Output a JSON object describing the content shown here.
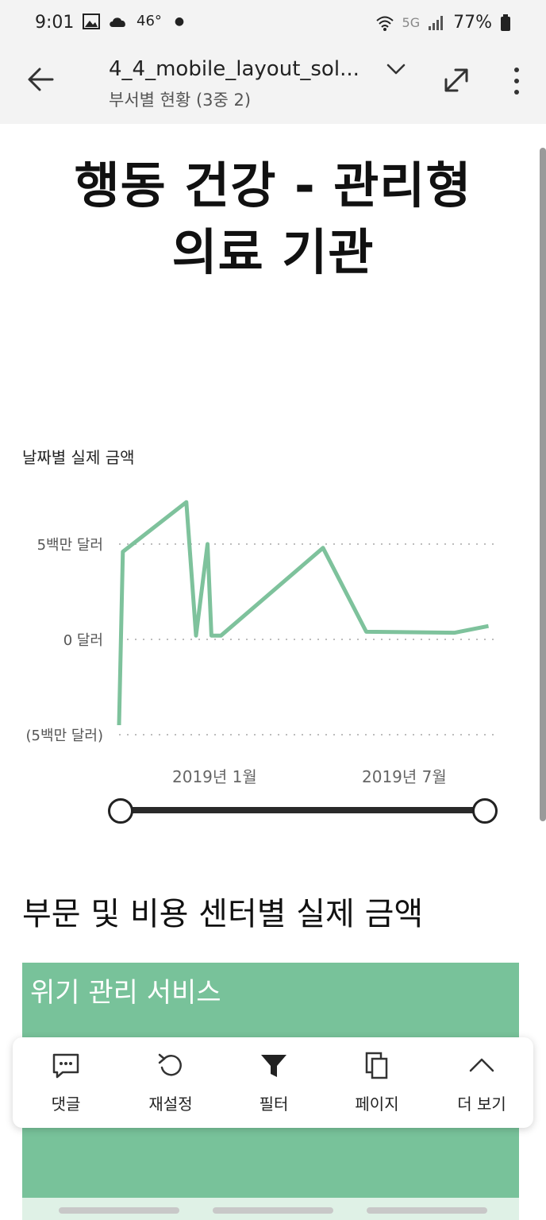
{
  "status_bar": {
    "time": "9:01",
    "temperature": "46°",
    "network": "5G",
    "battery": "77%"
  },
  "app_bar": {
    "title": "4_4_mobile_layout_sol...",
    "subtitle": "부서별 현황 (3중 2)"
  },
  "report": {
    "title_line1": "행동 건강 - 관리형",
    "title_line2": "의료 기관"
  },
  "chart_data": {
    "type": "line",
    "title": "날짜별 실제 금액",
    "y_ticks": [
      "5백만 달러",
      "0 달러",
      "(5백만 달러)"
    ],
    "x_ticks": [
      "2019년 1월",
      "2019년 7월"
    ],
    "x_range": [
      "2018-10",
      "2019-11"
    ],
    "ylim": [
      -5000000,
      8000000
    ],
    "grid": "horizontal-dotted",
    "color": "#7ec29c",
    "series": [
      {
        "points": [
          {
            "x": "2018-10-01",
            "y": -4500000
          },
          {
            "x": "2018-10-05",
            "y": 4600000
          },
          {
            "x": "2018-12-10",
            "y": 7200000
          },
          {
            "x": "2018-12-20",
            "y": 200000
          },
          {
            "x": "2019-01-01",
            "y": 5000000
          },
          {
            "x": "2019-01-05",
            "y": 200000
          },
          {
            "x": "2019-01-15",
            "y": 200000
          },
          {
            "x": "2019-05-01",
            "y": 4800000
          },
          {
            "x": "2019-06-15",
            "y": 400000
          },
          {
            "x": "2019-09-15",
            "y": 350000
          },
          {
            "x": "2019-10-20",
            "y": 700000
          }
        ]
      }
    ]
  },
  "slider": {
    "start": 0,
    "end": 1
  },
  "section": {
    "title": "부문 및 비용 센터별 실제 금액"
  },
  "treemap": {
    "top_label": "위기 관리 서비스",
    "color": "#78c29a"
  },
  "toolbar": {
    "comment": "댓글",
    "reset": "재설정",
    "filter": "필터",
    "page": "페이지",
    "more": "더 보기"
  }
}
